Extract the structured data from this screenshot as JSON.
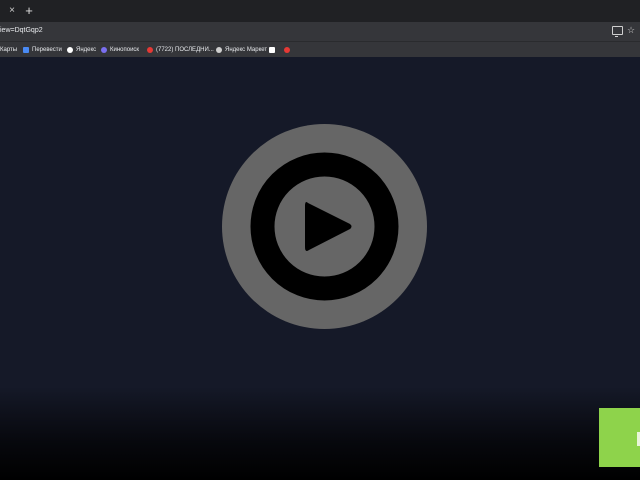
{
  "browser": {
    "tab": {
      "close_glyph": "×"
    },
    "new_tab_glyph": "+",
    "address_bar": {
      "url": "iew=DqtGqp2"
    },
    "toolbar_icons": {
      "cast": "cast-icon",
      "bookmark_star": "star-icon",
      "star_glyph": "☆"
    }
  },
  "bookmarks": [
    {
      "label": "Карты",
      "favicon_color": ""
    },
    {
      "label": "Перевести",
      "favicon_color": "#4a8af4"
    },
    {
      "label": "Яндекс",
      "favicon_color": "#ffffff"
    },
    {
      "label": "Кинопоиск",
      "favicon_color": "#7a6ff0"
    },
    {
      "label": "(7722) ПОСЛЕДНИ...",
      "favicon_color": "#e53935"
    },
    {
      "label": "Яндекс Маркет",
      "favicon_color": "#cfcfcf"
    },
    {
      "label": "",
      "favicon_color": "#ffffff"
    },
    {
      "label": "",
      "favicon_color": "#e53935"
    }
  ],
  "video": {
    "play_icon": "play-circle-icon",
    "colors": {
      "button_fill": "#666666",
      "inner_ring": "#000000",
      "background": "#151928"
    }
  },
  "overlay": {
    "accent_color": "#8ed34b"
  }
}
